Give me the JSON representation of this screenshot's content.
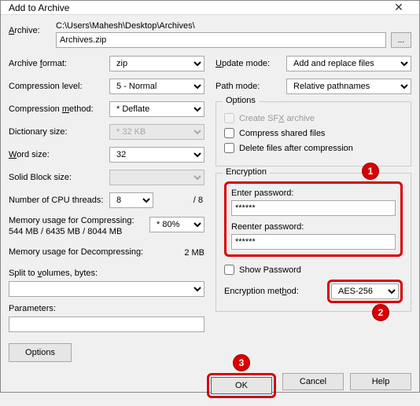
{
  "window": {
    "title": "Add to Archive"
  },
  "archive": {
    "label": "Archive:",
    "path": "C:\\Users\\Mahesh\\Desktop\\Archives\\",
    "filename": "Archives.zip",
    "browse": "..."
  },
  "left": {
    "format": {
      "label": "Archive format:",
      "value": "zip"
    },
    "compLevel": {
      "label": "Compression level:",
      "value": "5 - Normal"
    },
    "compMethod": {
      "label": "Compression method:",
      "value": "* Deflate"
    },
    "dictSize": {
      "label": "Dictionary size:",
      "value": "* 32 KB"
    },
    "wordSize": {
      "label": "Word size:",
      "value": "32"
    },
    "solidBlock": {
      "label": "Solid Block size:",
      "value": ""
    },
    "cpuThreads": {
      "label": "Number of CPU threads:",
      "value": "8",
      "total": "/ 8"
    },
    "memCompress": {
      "label": "Memory usage for Compressing:",
      "value": "* 80%",
      "detail": "544 MB / 6435 MB / 8044 MB"
    },
    "memDecompress": {
      "label": "Memory usage for Decompressing:",
      "value": "2 MB"
    },
    "splitVolumes": {
      "label": "Split to volumes, bytes:"
    },
    "parameters": {
      "label": "Parameters:"
    },
    "optionsBtn": "Options"
  },
  "right": {
    "updateMode": {
      "label": "Update mode:",
      "value": "Add and replace files"
    },
    "pathMode": {
      "label": "Path mode:",
      "value": "Relative pathnames"
    },
    "options": {
      "legend": "Options",
      "sfx": "Create SFX archive",
      "compressShared": "Compress shared files",
      "deleteAfter": "Delete files after compression"
    },
    "encryption": {
      "legend": "Encryption",
      "enter": "Enter password:",
      "reenter": "Reenter password:",
      "pwValue": "******",
      "showPassword": "Show Password",
      "methodLabel": "Encryption method:",
      "methodValue": "AES-256"
    }
  },
  "footer": {
    "ok": "OK",
    "cancel": "Cancel",
    "help": "Help"
  },
  "annotations": {
    "b1": "1",
    "b2": "2",
    "b3": "3"
  }
}
